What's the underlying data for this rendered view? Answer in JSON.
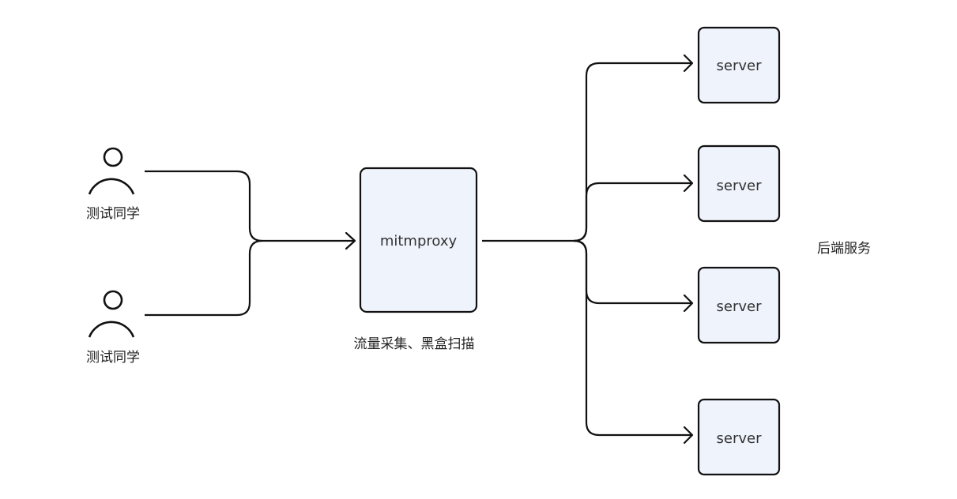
{
  "users": [
    {
      "label": "测试同学"
    },
    {
      "label": "测试同学"
    }
  ],
  "proxy": {
    "label": "mitmproxy",
    "caption": "流量采集、黑盒扫描"
  },
  "servers": [
    {
      "label": "server"
    },
    {
      "label": "server"
    },
    {
      "label": "server"
    },
    {
      "label": "server"
    }
  ],
  "backend_label": "后端服务",
  "colors": {
    "box_fill": "#eff3fc",
    "stroke": "#111111",
    "text": "#222222"
  },
  "icons": [
    "person-icon",
    "arrow-icon"
  ]
}
